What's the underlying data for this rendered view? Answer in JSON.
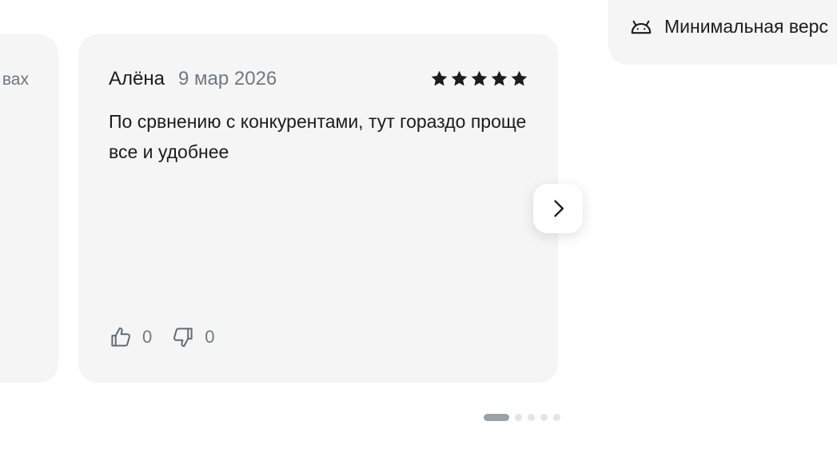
{
  "previous_review": {
    "text_fragment": "вах"
  },
  "review": {
    "author": "Алёна",
    "date": "9 мар 2026",
    "rating": 5,
    "rating_max": 5,
    "text": "По срвнению с конкурентами, тут гораздо проще все и удобнее",
    "likes": "0",
    "dislikes": "0"
  },
  "carousel": {
    "next_icon": "chevron-right-icon",
    "page_count": 5,
    "active_page": 0
  },
  "app_info": {
    "icon": "android-icon",
    "min_version_label": "Минимальная верс"
  },
  "colors": {
    "card_bg": "#f5f5f5",
    "star": "#1c1c1c",
    "muted_text": "#6e7985",
    "dot_active": "#9aa1aa",
    "dot_inactive": "#e2e4e7"
  }
}
